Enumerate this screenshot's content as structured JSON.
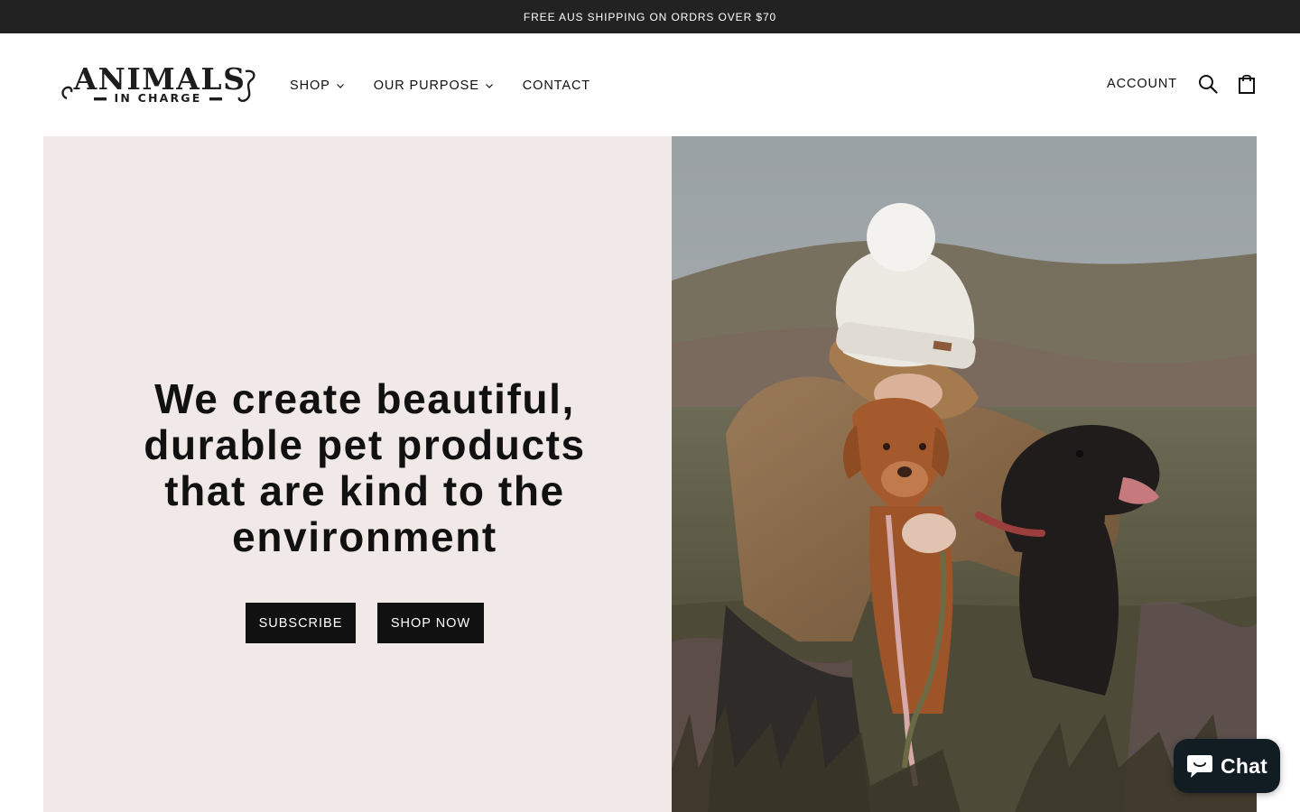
{
  "announcement": {
    "text": "FREE AUS SHIPPING ON ORDRS OVER $70"
  },
  "logo": {
    "line1": "ANIMALS",
    "line2": "IN CHARGE"
  },
  "nav": {
    "items": [
      {
        "label": "SHOP",
        "has_dropdown": true
      },
      {
        "label": "OUR PURPOSE",
        "has_dropdown": true
      },
      {
        "label": "CONTACT",
        "has_dropdown": false
      }
    ]
  },
  "header_actions": {
    "account_label": "ACCOUNT",
    "search_icon": "search-icon",
    "cart_icon": "shopping-bag-icon"
  },
  "hero": {
    "heading": "We create beautiful, durable pet products that are kind to the environment",
    "subscribe_label": "SUBSCRIBE",
    "shop_now_label": "SHOP NOW",
    "background_color": "#f1e9e8",
    "image_subject": "woman in white beanie hugging a red and a black labrador in heather field"
  },
  "chat": {
    "label": "Chat",
    "icon": "chat-bubble-icon"
  },
  "colors": {
    "announcement_bg": "#222222",
    "button_bg": "#111111",
    "chat_bg": "#111c23"
  }
}
